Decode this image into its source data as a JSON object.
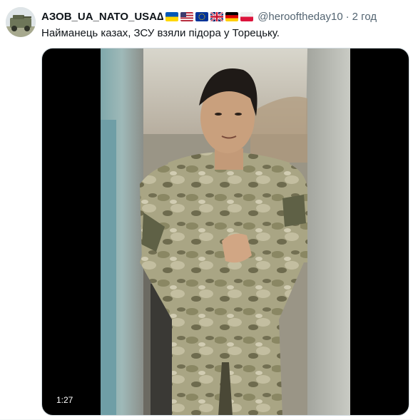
{
  "tweet": {
    "author_name": "АЗОВ_UA_NATO_USA∆",
    "handle": "@herooftheday10",
    "separator": "·",
    "time": "2 год",
    "text": "Найманець казах, ЗСУ взяли підора у Торецьку.",
    "flags": [
      "ukraine-flag-icon",
      "usa-flag-icon",
      "eu-flag-icon",
      "uk-flag-icon",
      "germany-flag-icon",
      "poland-flag-icon"
    ]
  },
  "media": {
    "duration": "1:27"
  },
  "colors": {
    "text": "#0f1419",
    "secondary": "#536471",
    "border": "#cfd9de"
  }
}
